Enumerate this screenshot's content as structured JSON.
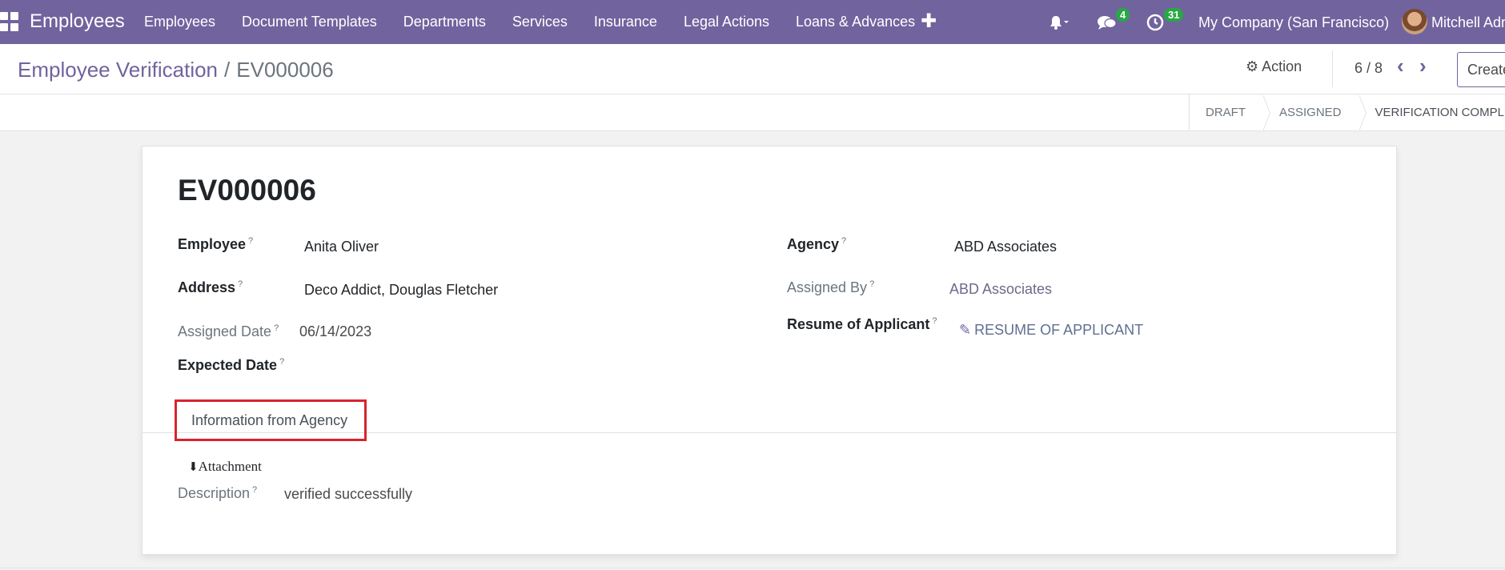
{
  "navbar": {
    "app_name": "Employees",
    "menu": [
      "Employees",
      "Document Templates",
      "Departments",
      "Services",
      "Insurance",
      "Legal Actions",
      "Loans & Advances"
    ],
    "plus": "✚",
    "chat_count": "4",
    "activity_count": "31",
    "company": "My Company (San Francisco)",
    "user": "Mitchell Admin",
    "color": "#71639e"
  },
  "control_panel": {
    "breadcrumb_parent": "Employee Verification",
    "breadcrumb_sep": "/",
    "breadcrumb_current": "EV000006",
    "action_label": "Action",
    "pager": "6 / 8",
    "create_label": "Create"
  },
  "statusbar": {
    "stages": [
      "DRAFT",
      "ASSIGNED",
      "VERIFICATION COMPLETED"
    ]
  },
  "form": {
    "title": "EV000006",
    "employee_label": "Employee",
    "employee_value": "Anita Oliver",
    "address_label": "Address",
    "address_value": "Deco Addict, Douglas Fletcher",
    "assigned_date_label": "Assigned Date",
    "assigned_date_value": "06/14/2023",
    "expected_date_label": "Expected Date",
    "agency_label": "Agency",
    "agency_value": "ABD Associates",
    "assigned_by_label": "Assigned By",
    "assigned_by_value": "ABD Associates",
    "resume_label": "Resume of Applicant",
    "resume_value": "RESUME OF APPLICANT",
    "help_mark": "?",
    "tab_label": "Information from Agency",
    "attachment_label": "Attachment",
    "description_label": "Description",
    "description_value": "verified successfully"
  },
  "icons": {
    "apps": "apps-grid-icon",
    "bell": "bell-icon",
    "chat": "chat-bubbles-icon",
    "clock": "clock-icon",
    "gear": "gear-icon",
    "prev": "chevron-left-icon",
    "next": "chevron-right-icon",
    "clip": "paperclip-icon",
    "download": "download-icon"
  }
}
